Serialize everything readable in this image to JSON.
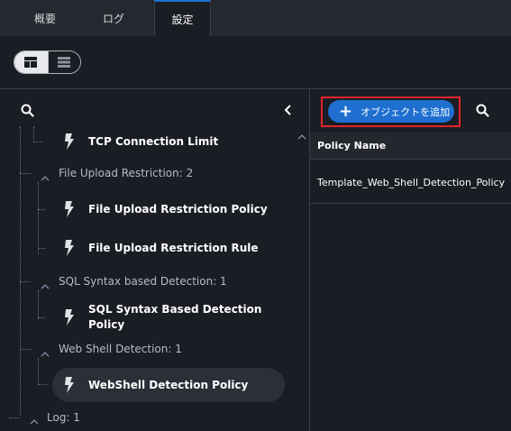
{
  "tabs": [
    {
      "label": "概要"
    },
    {
      "label": "ログ"
    },
    {
      "label": "設定"
    }
  ],
  "view_toggle": {
    "active": "split-view-icon",
    "inactive": "list-view-icon"
  },
  "left_panel": {
    "search_icon": "search-icon",
    "collapse_icon": "chevron-left-icon",
    "tree": {
      "tcp": {
        "label": "TCP Connection Limit"
      },
      "file_upload_group": {
        "label": "File Upload Restriction: 2"
      },
      "file_upload_policy": {
        "label": "File Upload Restriction Policy"
      },
      "file_upload_rule": {
        "label": "File Upload Restriction Rule"
      },
      "sql_group": {
        "label": "SQL Syntax based Detection: 1"
      },
      "sql_policy": {
        "line1": "SQL Syntax Based Detection",
        "line2": "Policy"
      },
      "webshell_group": {
        "label": "Web Shell Detection: 1"
      },
      "webshell_policy": {
        "label": "WebShell Detection Policy"
      },
      "log_group": {
        "label": "Log: 1"
      }
    }
  },
  "right_panel": {
    "add_button": {
      "icon": "plus-icon",
      "label": "オブジェクトを追加"
    },
    "search_icon": "search-icon",
    "table": {
      "headers": [
        "Policy Name"
      ],
      "rows": [
        [
          "Template_Web_Shell_Detection_Policy"
        ]
      ]
    }
  },
  "colors": {
    "background": "#1a1d23",
    "accent": "#1f6fd0",
    "highlight": "#e3242b"
  }
}
